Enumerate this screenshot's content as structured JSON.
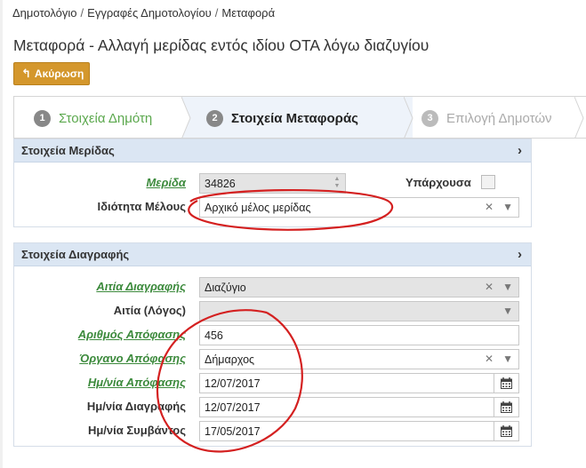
{
  "breadcrumb": {
    "items": [
      "Δημοτολόγιο",
      "Εγγραφές Δημοτολογίου",
      "Μεταφορά"
    ],
    "separator": "/"
  },
  "page_title": "Μεταφορά - Αλλαγή μερίδας εντός ιδίου ΟΤΑ λόγω διαζυγίου",
  "cancel_button": {
    "label": "Ακύρωση",
    "icon": "undo-arrow-icon",
    "color": "#d4972c"
  },
  "wizard": {
    "steps": [
      {
        "num": "1",
        "label": "Στοιχεία Δημότη",
        "state": "completed",
        "color": "#5ba84d"
      },
      {
        "num": "2",
        "label": "Στοιχεία Μεταφοράς",
        "state": "active",
        "color": "#222222"
      },
      {
        "num": "3",
        "label": "Επιλογή Δημοτών",
        "state": "pending",
        "color": "#aaaaaa"
      }
    ]
  },
  "panel_merida": {
    "title": "Στοιχεία Μερίδας",
    "merida_label": "Μερίδα",
    "merida_value": "34826",
    "existing_label": "Υπάρχουσα",
    "existing_checked": false,
    "member_label": "Ιδιότητα Μέλους",
    "member_value": "Αρχικό μέλος μερίδας"
  },
  "panel_deletion": {
    "title": "Στοιχεία Διαγραφής",
    "reason_label": "Αιτία Διαγραφής",
    "reason_value": "Διαζύγιο",
    "cause_label": "Αιτία (Λόγος)",
    "cause_value": "",
    "decision_num_label": "Αριθμός Απόφασης",
    "decision_num_value": "456",
    "organ_label": "Όργανο Απόφασης",
    "organ_value": "Δήμαρχος",
    "decision_date_label": "Ημ/νία Απόφασης",
    "decision_date_value": "12/07/2017",
    "deletion_date_label": "Ημ/νία Διαγραφής",
    "deletion_date_value": "12/07/2017",
    "event_date_label": "Ημ/νία Συμβάντος",
    "event_date_value": "17/05/2017"
  },
  "colors": {
    "accent_green": "#3c8a3c",
    "panel_header": "#dbe6f3",
    "annotation_red": "#d42020"
  }
}
